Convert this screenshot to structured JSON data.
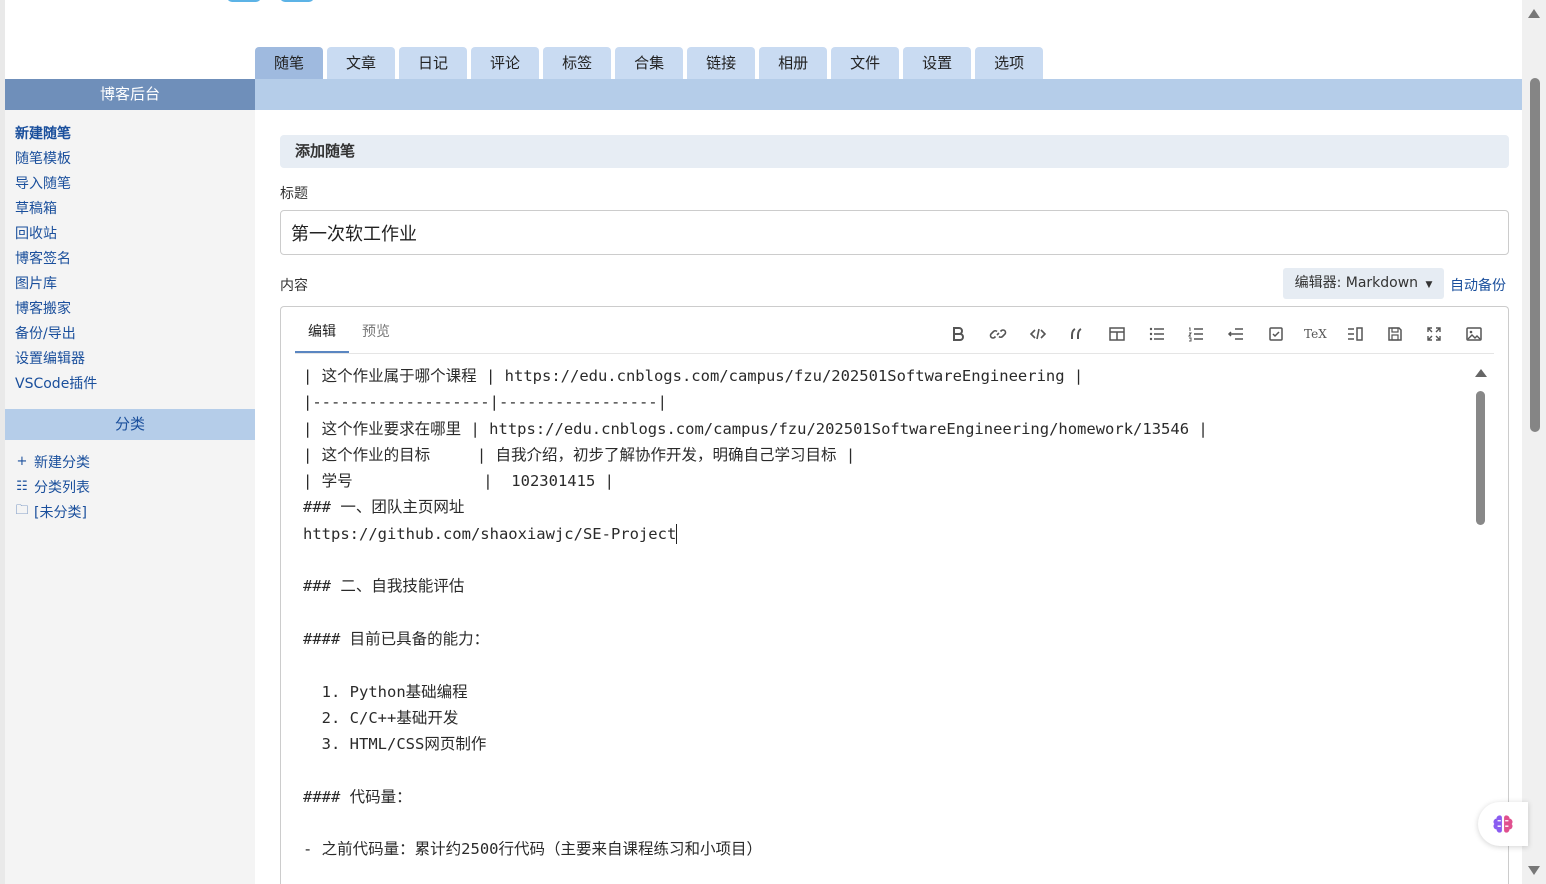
{
  "top_tabs": [
    "随笔",
    "文章",
    "日记",
    "评论",
    "标签",
    "合集",
    "链接",
    "相册",
    "文件",
    "设置",
    "选项"
  ],
  "active_tab": "随笔",
  "sidebar": {
    "title": "博客后台",
    "items": [
      "新建随笔",
      "随笔模板",
      "导入随笔",
      "草稿箱",
      "回收站",
      "博客签名",
      "图片库",
      "博客搬家",
      "备份/导出",
      "设置编辑器",
      "VSCode插件"
    ],
    "category_title": "分类",
    "category_items": [
      {
        "icon": "plus-icon",
        "label": "新建分类"
      },
      {
        "icon": "list-icon",
        "label": "分类列表"
      },
      {
        "icon": "folder-icon",
        "label": "[未分类]"
      }
    ]
  },
  "form": {
    "section_title": "添加随笔",
    "title_label": "标题",
    "title_value": "第一次软工作业",
    "content_label": "内容",
    "editor_select": "编辑器: Markdown",
    "autosave": "自动备份"
  },
  "editor": {
    "tabs": [
      "编辑",
      "预览"
    ],
    "active_tab": "编辑",
    "toolbar": [
      "bold-icon",
      "link-icon",
      "code-icon",
      "quote-icon",
      "table-icon",
      "unordered-list-icon",
      "ordered-list-icon",
      "indent-icon",
      "checkbox-icon",
      "tex-icon",
      "split-view-icon",
      "save-icon",
      "fullscreen-icon",
      "image-icon"
    ],
    "lines": [
      "| 这个作业属于哪个课程 | https://edu.cnblogs.com/campus/fzu/202501SoftwareEngineering |",
      "|-------------------|-----------------|",
      "| 这个作业要求在哪里 | https://edu.cnblogs.com/campus/fzu/202501SoftwareEngineering/homework/13546 |",
      "| 这个作业的目标     | 自我介绍，初步了解协作开发，明确自己学习目标 |",
      "| 学号              |  102301415 |",
      "### 一、团队主页网址",
      "https://github.com/shaoxiawjc/SE-Project",
      "",
      "### 二、自我技能评估",
      "",
      "#### 目前已具备的能力：",
      "",
      "  1. Python基础编程",
      "  2. C/C++基础开发",
      "  3. HTML/CSS网页制作",
      "",
      "#### 代码量：",
      "",
      "- 之前代码量：累计约2500行代码（主要来自课程练习和小项目）"
    ]
  },
  "colors": {
    "tab_bg": "#c9dbf2",
    "tab_active": "#9fbadf",
    "sidebar_head": "#6f8fba",
    "link": "#1a4f9c"
  }
}
